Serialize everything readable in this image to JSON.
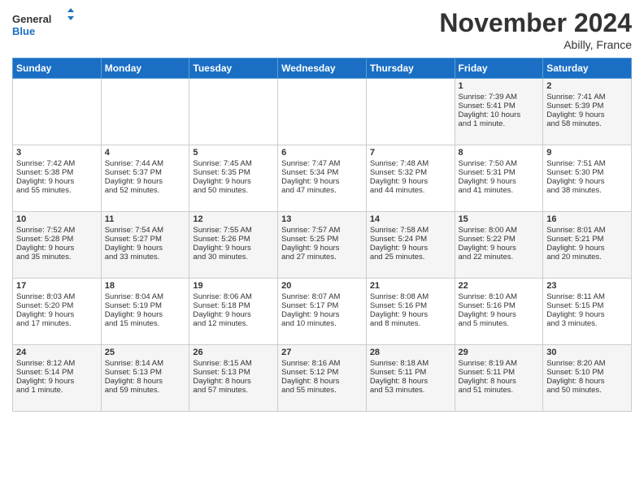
{
  "header": {
    "logo_line1": "General",
    "logo_line2": "Blue",
    "month_title": "November 2024",
    "subtitle": "Abilly, France"
  },
  "weekdays": [
    "Sunday",
    "Monday",
    "Tuesday",
    "Wednesday",
    "Thursday",
    "Friday",
    "Saturday"
  ],
  "weeks": [
    [
      {
        "day": "",
        "lines": []
      },
      {
        "day": "",
        "lines": []
      },
      {
        "day": "",
        "lines": []
      },
      {
        "day": "",
        "lines": []
      },
      {
        "day": "",
        "lines": []
      },
      {
        "day": "1",
        "lines": [
          "Sunrise: 7:39 AM",
          "Sunset: 5:41 PM",
          "Daylight: 10 hours",
          "and 1 minute."
        ]
      },
      {
        "day": "2",
        "lines": [
          "Sunrise: 7:41 AM",
          "Sunset: 5:39 PM",
          "Daylight: 9 hours",
          "and 58 minutes."
        ]
      }
    ],
    [
      {
        "day": "3",
        "lines": [
          "Sunrise: 7:42 AM",
          "Sunset: 5:38 PM",
          "Daylight: 9 hours",
          "and 55 minutes."
        ]
      },
      {
        "day": "4",
        "lines": [
          "Sunrise: 7:44 AM",
          "Sunset: 5:37 PM",
          "Daylight: 9 hours",
          "and 52 minutes."
        ]
      },
      {
        "day": "5",
        "lines": [
          "Sunrise: 7:45 AM",
          "Sunset: 5:35 PM",
          "Daylight: 9 hours",
          "and 50 minutes."
        ]
      },
      {
        "day": "6",
        "lines": [
          "Sunrise: 7:47 AM",
          "Sunset: 5:34 PM",
          "Daylight: 9 hours",
          "and 47 minutes."
        ]
      },
      {
        "day": "7",
        "lines": [
          "Sunrise: 7:48 AM",
          "Sunset: 5:32 PM",
          "Daylight: 9 hours",
          "and 44 minutes."
        ]
      },
      {
        "day": "8",
        "lines": [
          "Sunrise: 7:50 AM",
          "Sunset: 5:31 PM",
          "Daylight: 9 hours",
          "and 41 minutes."
        ]
      },
      {
        "day": "9",
        "lines": [
          "Sunrise: 7:51 AM",
          "Sunset: 5:30 PM",
          "Daylight: 9 hours",
          "and 38 minutes."
        ]
      }
    ],
    [
      {
        "day": "10",
        "lines": [
          "Sunrise: 7:52 AM",
          "Sunset: 5:28 PM",
          "Daylight: 9 hours",
          "and 35 minutes."
        ]
      },
      {
        "day": "11",
        "lines": [
          "Sunrise: 7:54 AM",
          "Sunset: 5:27 PM",
          "Daylight: 9 hours",
          "and 33 minutes."
        ]
      },
      {
        "day": "12",
        "lines": [
          "Sunrise: 7:55 AM",
          "Sunset: 5:26 PM",
          "Daylight: 9 hours",
          "and 30 minutes."
        ]
      },
      {
        "day": "13",
        "lines": [
          "Sunrise: 7:57 AM",
          "Sunset: 5:25 PM",
          "Daylight: 9 hours",
          "and 27 minutes."
        ]
      },
      {
        "day": "14",
        "lines": [
          "Sunrise: 7:58 AM",
          "Sunset: 5:24 PM",
          "Daylight: 9 hours",
          "and 25 minutes."
        ]
      },
      {
        "day": "15",
        "lines": [
          "Sunrise: 8:00 AM",
          "Sunset: 5:22 PM",
          "Daylight: 9 hours",
          "and 22 minutes."
        ]
      },
      {
        "day": "16",
        "lines": [
          "Sunrise: 8:01 AM",
          "Sunset: 5:21 PM",
          "Daylight: 9 hours",
          "and 20 minutes."
        ]
      }
    ],
    [
      {
        "day": "17",
        "lines": [
          "Sunrise: 8:03 AM",
          "Sunset: 5:20 PM",
          "Daylight: 9 hours",
          "and 17 minutes."
        ]
      },
      {
        "day": "18",
        "lines": [
          "Sunrise: 8:04 AM",
          "Sunset: 5:19 PM",
          "Daylight: 9 hours",
          "and 15 minutes."
        ]
      },
      {
        "day": "19",
        "lines": [
          "Sunrise: 8:06 AM",
          "Sunset: 5:18 PM",
          "Daylight: 9 hours",
          "and 12 minutes."
        ]
      },
      {
        "day": "20",
        "lines": [
          "Sunrise: 8:07 AM",
          "Sunset: 5:17 PM",
          "Daylight: 9 hours",
          "and 10 minutes."
        ]
      },
      {
        "day": "21",
        "lines": [
          "Sunrise: 8:08 AM",
          "Sunset: 5:16 PM",
          "Daylight: 9 hours",
          "and 8 minutes."
        ]
      },
      {
        "day": "22",
        "lines": [
          "Sunrise: 8:10 AM",
          "Sunset: 5:16 PM",
          "Daylight: 9 hours",
          "and 5 minutes."
        ]
      },
      {
        "day": "23",
        "lines": [
          "Sunrise: 8:11 AM",
          "Sunset: 5:15 PM",
          "Daylight: 9 hours",
          "and 3 minutes."
        ]
      }
    ],
    [
      {
        "day": "24",
        "lines": [
          "Sunrise: 8:12 AM",
          "Sunset: 5:14 PM",
          "Daylight: 9 hours",
          "and 1 minute."
        ]
      },
      {
        "day": "25",
        "lines": [
          "Sunrise: 8:14 AM",
          "Sunset: 5:13 PM",
          "Daylight: 8 hours",
          "and 59 minutes."
        ]
      },
      {
        "day": "26",
        "lines": [
          "Sunrise: 8:15 AM",
          "Sunset: 5:13 PM",
          "Daylight: 8 hours",
          "and 57 minutes."
        ]
      },
      {
        "day": "27",
        "lines": [
          "Sunrise: 8:16 AM",
          "Sunset: 5:12 PM",
          "Daylight: 8 hours",
          "and 55 minutes."
        ]
      },
      {
        "day": "28",
        "lines": [
          "Sunrise: 8:18 AM",
          "Sunset: 5:11 PM",
          "Daylight: 8 hours",
          "and 53 minutes."
        ]
      },
      {
        "day": "29",
        "lines": [
          "Sunrise: 8:19 AM",
          "Sunset: 5:11 PM",
          "Daylight: 8 hours",
          "and 51 minutes."
        ]
      },
      {
        "day": "30",
        "lines": [
          "Sunrise: 8:20 AM",
          "Sunset: 5:10 PM",
          "Daylight: 8 hours",
          "and 50 minutes."
        ]
      }
    ]
  ]
}
